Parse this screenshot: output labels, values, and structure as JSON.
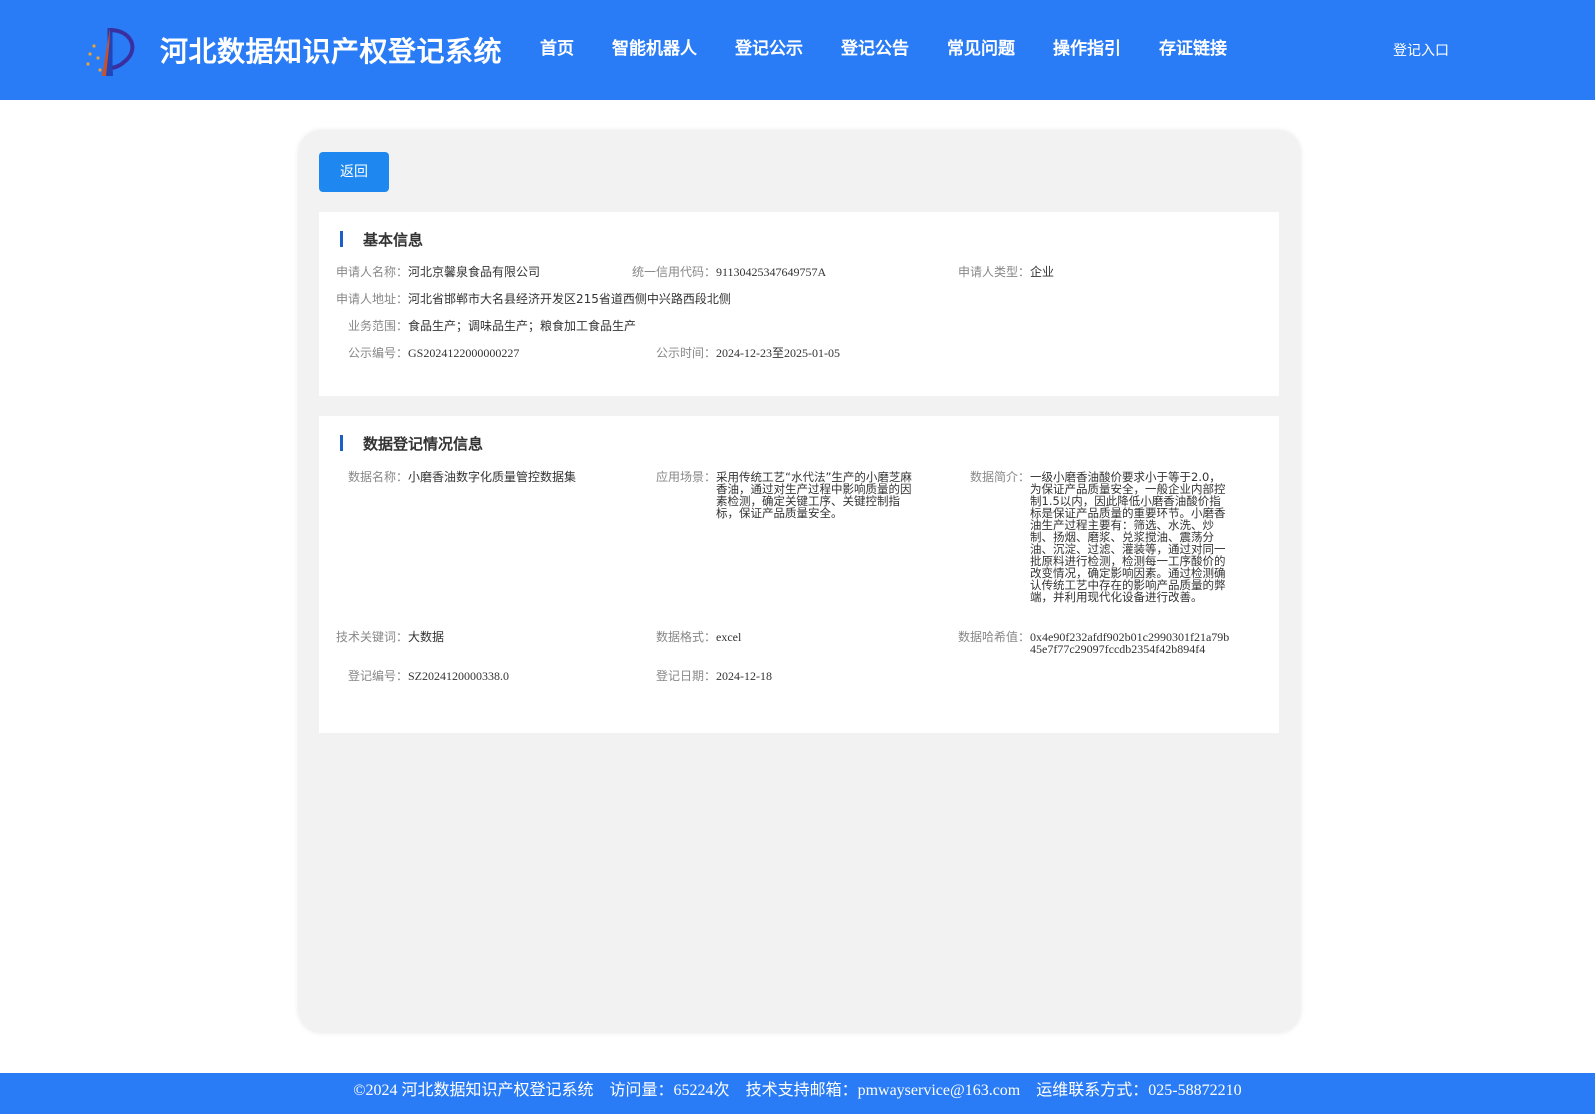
{
  "header": {
    "title": "河北数据知识产权登记系统",
    "nav": [
      "首页",
      "智能机器人",
      "登记公示",
      "登记公告",
      "常见问题",
      "操作指引",
      "存证链接"
    ],
    "login": "登记入口"
  },
  "back_label": "返回",
  "basic": {
    "title": "基本信息",
    "applicant_name_label": "申请人名称：",
    "applicant_name": "河北京馨泉食品有限公司",
    "credit_code_label": "统一信用代码：",
    "credit_code": "91130425347649757A",
    "applicant_type_label": "申请人类型：",
    "applicant_type": "企业",
    "address_label": "申请人地址：",
    "address": "河北省邯郸市大名县经济开发区215省道西侧中兴路西段北侧",
    "scope_label": "业务范围：",
    "scope": "食品生产；调味品生产；粮食加工食品生产",
    "notice_no_label": "公示编号：",
    "notice_no": "GS2024122000000227",
    "notice_time_label": "公示时间：",
    "notice_time": "2024-12-23至2025-01-05"
  },
  "data_reg": {
    "title": "数据登记情况信息",
    "data_name_label": "数据名称：",
    "data_name": "小磨香油数字化质量管控数据集",
    "scene_label": "应用场景：",
    "scene": "采用传统工艺“水代法”生产的小磨芝麻香油，通过对生产过程中影响质量的因素检测，确定关键工序、关键控制指标，保证产品质量安全。",
    "intro_label": "数据简介：",
    "intro": "一级小磨香油酸价要求小于等于2.0，为保证产品质量安全，一般企业内部控制1.5以内，因此降低小磨香油酸价指标是保证产品质量的重要环节。小磨香油生产过程主要有：筛选、水洗、炒制、扬烟、磨浆、兑浆搅油、震荡分油、沉淀、过滤、灌装等，通过对同一批原料进行检测，检测每一工序酸价的改变情况，确定影响因素。通过检测确认传统工艺中存在的影响产品质量的弊端，并利用现代化设备进行改善。",
    "keyword_label": "技术关键词：",
    "keyword": "大数据",
    "format_label": "数据格式：",
    "format": "excel",
    "hash_label": "数据哈希值：",
    "hash": "0x4e90f232afdf902b01c2990301f21a79b45e7f77c29097fccdb2354f42b894f4",
    "reg_no_label": "登记编号：",
    "reg_no": "SZ2024120000338.0",
    "reg_date_label": "登记日期：",
    "reg_date": "2024-12-18"
  },
  "footer": {
    "copyright": "©2024 河北数据知识产权登记系统",
    "visits": "访问量：65224次",
    "email": "技术支持邮箱：pmwayservice@163.com",
    "ops": "运维联系方式：025-58872210"
  }
}
